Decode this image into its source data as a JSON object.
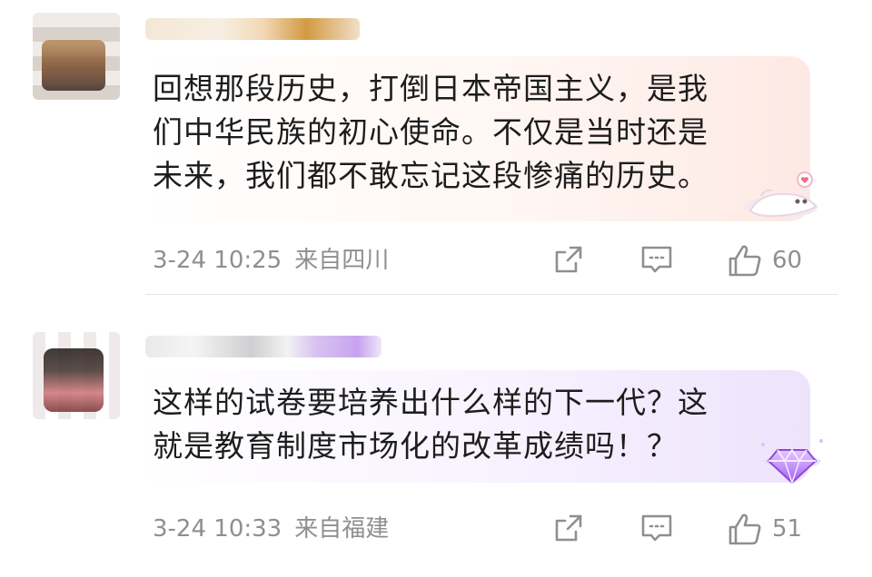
{
  "comments": [
    {
      "text_lines": [
        "回想那段历史，打倒日本帝国主义，是我",
        "们中华民族的初心使命。不仅是当时还是",
        "未来，我们都不敢忘记这段惨痛的历史。"
      ],
      "time": "3-24 10:25",
      "location": "来自四川",
      "likes": "60",
      "icons": {
        "share": "share-icon",
        "comment": "comment-icon",
        "like": "thumbs-up-icon",
        "sticker": "cat-sticker-icon"
      }
    },
    {
      "text_lines": [
        "这样的试卷要培养出什么样的下一代？这",
        "就是教育制度市场化的改革成绩吗！？"
      ],
      "time": "3-24 10:33",
      "location": "来自福建",
      "likes": "51",
      "icons": {
        "share": "share-icon",
        "comment": "comment-icon",
        "like": "thumbs-up-icon",
        "sticker": "gem-badge-icon"
      }
    }
  ],
  "colors": {
    "text": "#1d1d1d",
    "meta": "#8f8f8f",
    "bubble_warm": "#fde9e4",
    "bubble_purple": "#ede3fb",
    "divider": "#e6e6e6"
  }
}
